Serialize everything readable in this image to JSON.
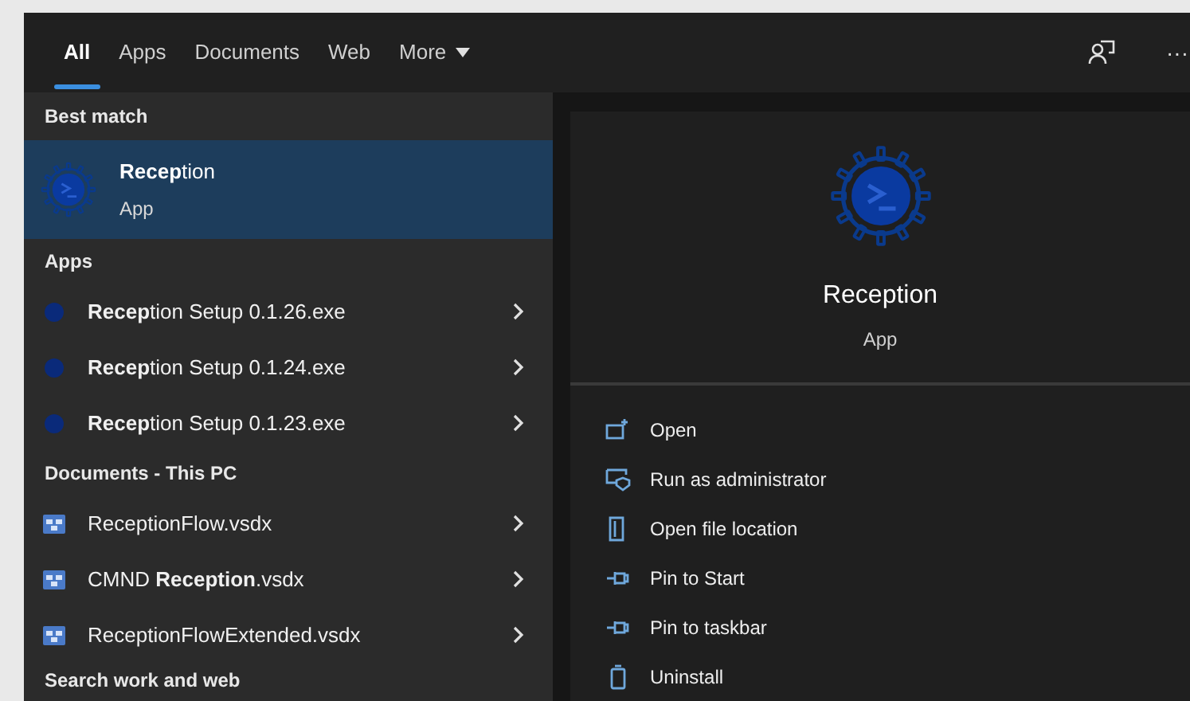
{
  "tabs": [
    {
      "label": "All",
      "selected": true
    },
    {
      "label": "Apps",
      "selected": false
    },
    {
      "label": "Documents",
      "selected": false
    },
    {
      "label": "Web",
      "selected": false
    },
    {
      "label": "More",
      "selected": false,
      "kind": "dropdown"
    }
  ],
  "toolbar": {
    "more": "···"
  },
  "results": [
    {
      "header": "Best match",
      "items": [
        {
          "kind": "best",
          "title": "**Recep**tion",
          "subtitle": "App",
          "selected": true
        }
      ]
    },
    {
      "header": "Apps",
      "items": [
        {
          "kind": "app",
          "title": "**Recep**tion Setup 0.1.26.exe",
          "selected": false
        },
        {
          "kind": "app",
          "title": "**Recep**tion Setup 0.1.24.exe",
          "selected": false
        },
        {
          "kind": "app",
          "title": "**Recep**tion Setup 0.1.23.exe",
          "selected": false
        }
      ]
    },
    {
      "header": "Documents - This PC",
      "items": [
        {
          "kind": "doc",
          "title": "ReceptionFlow.vsdx",
          "selected": false
        },
        {
          "kind": "doc",
          "title": "CMND **Reception**.vsdx",
          "selected": false
        },
        {
          "kind": "doc",
          "title": "ReceptionFlowExtended.vsdx",
          "selected": false
        }
      ]
    },
    {
      "header": "Search work and web"
    }
  ],
  "preview": {
    "title": "Reception",
    "subtitle": "App",
    "actions": [
      {
        "label": "Open",
        "kind": "open"
      },
      {
        "label": "Run as administrator",
        "kind": "admin"
      },
      {
        "label": "Open file location",
        "kind": "folder"
      },
      {
        "label": "Pin to Start",
        "kind": "pin"
      },
      {
        "label": "Pin to taskbar",
        "kind": "pin"
      },
      {
        "label": "Uninstall",
        "kind": "trash"
      }
    ]
  }
}
